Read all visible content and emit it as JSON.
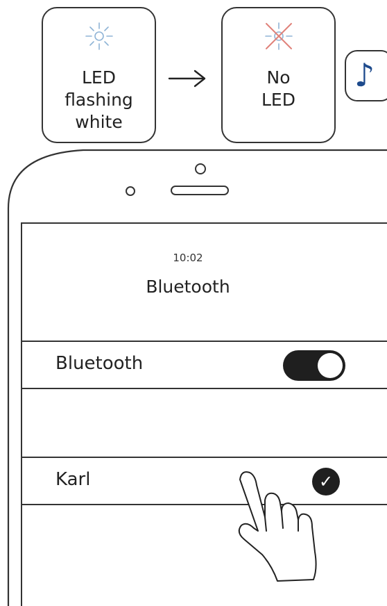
{
  "led_sequence": {
    "on_state": {
      "label": "LED\nflashing\nwhite"
    },
    "off_state": {
      "label": "No\nLED"
    },
    "sound_indicator": {
      "glyph": "♪",
      "icon": "music-note-icon"
    }
  },
  "phone": {
    "status": {
      "time": "10:02"
    },
    "screen_title": "Bluetooth",
    "bluetooth_row": {
      "label": "Bluetooth",
      "toggle_on": true
    },
    "device_row": {
      "label": "Karl",
      "selected_glyph": "✓"
    }
  },
  "colors": {
    "led_white_rays": "#8fb4d6",
    "led_off_cross": "#e0827a",
    "note": "#1d4a8c",
    "outline": "#333333",
    "toggle": "#1f1f1f"
  }
}
